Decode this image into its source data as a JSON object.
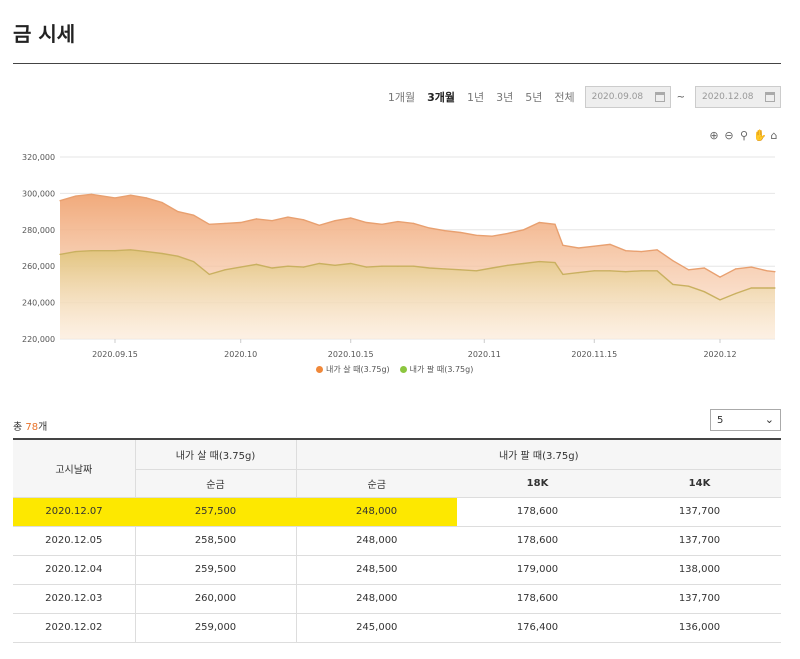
{
  "page": {
    "title": "금 시세"
  },
  "period": {
    "options": [
      "1개월",
      "3개월",
      "1년",
      "3년",
      "5년",
      "전체"
    ],
    "active_index": 1,
    "start_date": "2020.09.08",
    "end_date": "2020.12.08",
    "separator": "~"
  },
  "tools": [
    "zoom-in-icon",
    "zoom-out-icon",
    "magnify-icon",
    "pan-hand-icon",
    "home-icon"
  ],
  "colors": {
    "buy": "#f0883a",
    "sell": "#8cc63f",
    "highlight": "#fde800",
    "accent": "#e8732a"
  },
  "chart_data": {
    "type": "area",
    "ylim": [
      220000,
      320000
    ],
    "yticks": [
      220000,
      240000,
      260000,
      280000,
      300000,
      320000
    ],
    "ytick_labels": [
      "220,000",
      "240,000",
      "260,000",
      "280,000",
      "300,000",
      "320,000"
    ],
    "x_range": [
      "2020-09-08",
      "2020-12-08"
    ],
    "xticks": [
      {
        "date": "2020-09-15",
        "label": "2020.09.15"
      },
      {
        "date": "2020-10-01",
        "label": "2020.10"
      },
      {
        "date": "2020-10-15",
        "label": "2020.10.15"
      },
      {
        "date": "2020-11-01",
        "label": "2020.11"
      },
      {
        "date": "2020-11-15",
        "label": "2020.11.15"
      },
      {
        "date": "2020-12-01",
        "label": "2020.12"
      }
    ],
    "series": [
      {
        "name": "내가 살 때(3.75g)",
        "color": "#f0883a",
        "points": [
          [
            "2020-09-08",
            296000
          ],
          [
            "2020-09-10",
            298500
          ],
          [
            "2020-09-12",
            299500
          ],
          [
            "2020-09-15",
            297500
          ],
          [
            "2020-09-17",
            299000
          ],
          [
            "2020-09-19",
            297500
          ],
          [
            "2020-09-21",
            295000
          ],
          [
            "2020-09-23",
            290000
          ],
          [
            "2020-09-25",
            288000
          ],
          [
            "2020-09-27",
            283000
          ],
          [
            "2020-09-29",
            283500
          ],
          [
            "2020-10-01",
            284000
          ],
          [
            "2020-10-03",
            286000
          ],
          [
            "2020-10-05",
            285000
          ],
          [
            "2020-10-07",
            287000
          ],
          [
            "2020-10-09",
            285500
          ],
          [
            "2020-10-11",
            282500
          ],
          [
            "2020-10-13",
            285000
          ],
          [
            "2020-10-15",
            286500
          ],
          [
            "2020-10-17",
            284000
          ],
          [
            "2020-10-19",
            283000
          ],
          [
            "2020-10-21",
            284500
          ],
          [
            "2020-10-23",
            283500
          ],
          [
            "2020-10-25",
            281000
          ],
          [
            "2020-10-27",
            279500
          ],
          [
            "2020-10-29",
            278500
          ],
          [
            "2020-10-31",
            277000
          ],
          [
            "2020-11-02",
            276500
          ],
          [
            "2020-11-04",
            278000
          ],
          [
            "2020-11-06",
            280000
          ],
          [
            "2020-11-08",
            284000
          ],
          [
            "2020-11-10",
            283000
          ],
          [
            "2020-11-11",
            271500
          ],
          [
            "2020-11-13",
            270000
          ],
          [
            "2020-11-15",
            271000
          ],
          [
            "2020-11-17",
            272000
          ],
          [
            "2020-11-19",
            268500
          ],
          [
            "2020-11-21",
            268000
          ],
          [
            "2020-11-23",
            269000
          ],
          [
            "2020-11-25",
            263000
          ],
          [
            "2020-11-27",
            258000
          ],
          [
            "2020-11-29",
            259000
          ],
          [
            "2020-12-01",
            254000
          ],
          [
            "2020-12-03",
            258500
          ],
          [
            "2020-12-05",
            259500
          ],
          [
            "2020-12-07",
            257500
          ],
          [
            "2020-12-08",
            257000
          ]
        ]
      },
      {
        "name": "내가 팔 때(3.75g)",
        "color": "#8cc63f",
        "points": [
          [
            "2020-09-08",
            266500
          ],
          [
            "2020-09-10",
            268000
          ],
          [
            "2020-09-12",
            268500
          ],
          [
            "2020-09-15",
            268500
          ],
          [
            "2020-09-17",
            269000
          ],
          [
            "2020-09-19",
            268000
          ],
          [
            "2020-09-21",
            267000
          ],
          [
            "2020-09-23",
            265500
          ],
          [
            "2020-09-25",
            262500
          ],
          [
            "2020-09-27",
            255500
          ],
          [
            "2020-09-29",
            258000
          ],
          [
            "2020-10-01",
            259500
          ],
          [
            "2020-10-03",
            261000
          ],
          [
            "2020-10-05",
            259000
          ],
          [
            "2020-10-07",
            260000
          ],
          [
            "2020-10-09",
            259500
          ],
          [
            "2020-10-11",
            261500
          ],
          [
            "2020-10-13",
            260500
          ],
          [
            "2020-10-15",
            261500
          ],
          [
            "2020-10-17",
            259500
          ],
          [
            "2020-10-19",
            260000
          ],
          [
            "2020-10-21",
            260000
          ],
          [
            "2020-10-23",
            260000
          ],
          [
            "2020-10-25",
            259000
          ],
          [
            "2020-10-27",
            258500
          ],
          [
            "2020-10-29",
            258000
          ],
          [
            "2020-10-31",
            257500
          ],
          [
            "2020-11-02",
            259000
          ],
          [
            "2020-11-04",
            260500
          ],
          [
            "2020-11-06",
            261500
          ],
          [
            "2020-11-08",
            262500
          ],
          [
            "2020-11-10",
            262000
          ],
          [
            "2020-11-11",
            255500
          ],
          [
            "2020-11-13",
            256500
          ],
          [
            "2020-11-15",
            257500
          ],
          [
            "2020-11-17",
            257500
          ],
          [
            "2020-11-19",
            257000
          ],
          [
            "2020-11-21",
            257500
          ],
          [
            "2020-11-23",
            257500
          ],
          [
            "2020-11-25",
            250000
          ],
          [
            "2020-11-27",
            249000
          ],
          [
            "2020-11-29",
            246000
          ],
          [
            "2020-12-01",
            241500
          ],
          [
            "2020-12-03",
            245000
          ],
          [
            "2020-12-05",
            248000
          ],
          [
            "2020-12-07",
            248000
          ],
          [
            "2020-12-08",
            248000
          ]
        ]
      }
    ]
  },
  "list": {
    "total_prefix": "총 ",
    "total_count": "78",
    "total_suffix": "개",
    "page_size": "5"
  },
  "table": {
    "header_date": "고시날짜",
    "header_buy": "내가 살 때(3.75g)",
    "header_sell": "내가 팔 때(3.75g)",
    "sub_buy_pure": "순금",
    "sub_sell_pure": "순금",
    "sub_18k": "18K",
    "sub_14k": "14K",
    "rows": [
      {
        "date": "2020.12.07",
        "buy": "257,500",
        "sell": "248,000",
        "k18": "178,600",
        "k14": "137,700"
      },
      {
        "date": "2020.12.05",
        "buy": "258,500",
        "sell": "248,000",
        "k18": "178,600",
        "k14": "137,700"
      },
      {
        "date": "2020.12.04",
        "buy": "259,500",
        "sell": "248,500",
        "k18": "179,000",
        "k14": "138,000"
      },
      {
        "date": "2020.12.03",
        "buy": "260,000",
        "sell": "248,000",
        "k18": "178,600",
        "k14": "137,700"
      },
      {
        "date": "2020.12.02",
        "buy": "259,000",
        "sell": "245,000",
        "k18": "176,400",
        "k14": "136,000"
      }
    ]
  }
}
